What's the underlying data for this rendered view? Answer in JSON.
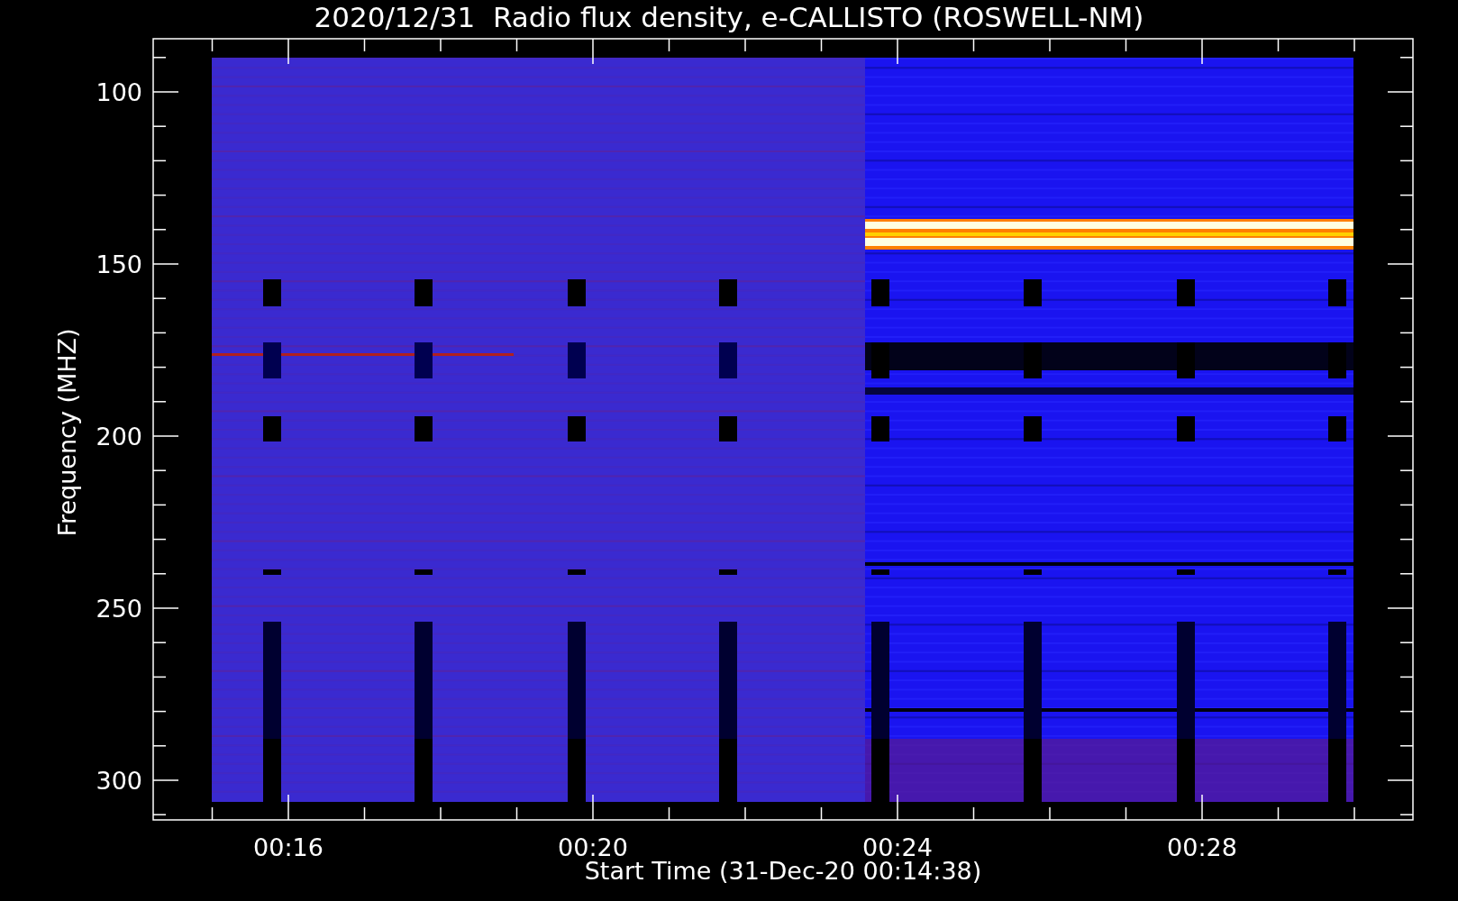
{
  "title": "2020/12/31  Radio flux density, e-CALLISTO (ROSWELL-NM)",
  "y_axis": {
    "label": "Frequency (MHZ)",
    "ticks": [
      "100",
      "150",
      "200",
      "250",
      "300"
    ]
  },
  "x_axis": {
    "label": "Start Time (31-Dec-20 00:14:38)",
    "ticks": [
      "00:16",
      "00:20",
      "00:24",
      "00:28"
    ]
  }
}
